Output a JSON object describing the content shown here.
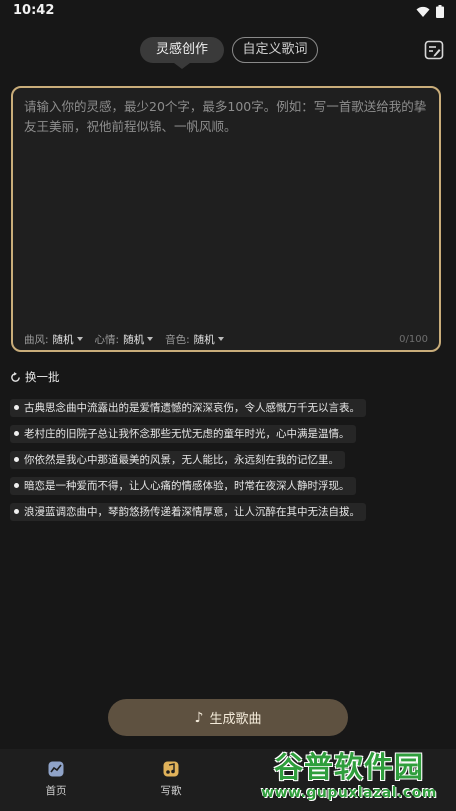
{
  "status_bar": {
    "time": "10:42"
  },
  "tabs": {
    "active": "灵感创作",
    "inactive": "自定义歌词"
  },
  "input": {
    "placeholder": "请输入你的灵感，最少20个字，最多100字。例如：写一首歌送给我的挚友王美丽，祝他前程似锦、一帆风顺。",
    "char_count": "0/100"
  },
  "options": [
    {
      "label": "曲风:",
      "value": "随机"
    },
    {
      "label": "心情:",
      "value": "随机"
    },
    {
      "label": "音色:",
      "value": "随机"
    }
  ],
  "refresh_label": "换一批",
  "suggestions": [
    "古典思念曲中流露出的是爱情遗憾的深深哀伤，令人感慨万千无以言表。",
    "老村庄的旧院子总让我怀念那些无忧无虑的童年时光，心中满是温情。",
    "你依然是我心中那道最美的风景，无人能比，永远刻在我的记忆里。",
    "暗恋是一种爱而不得，让人心痛的情感体验，时常在夜深人静时浮现。",
    "浪漫蓝调恋曲中，琴韵悠扬传递着深情厚意，让人沉醉在其中无法自拔。"
  ],
  "generate_button": "生成歌曲",
  "bottom_nav": [
    {
      "label": "首页",
      "icon": "home-chart-icon"
    },
    {
      "label": "写歌",
      "icon": "music-write-icon"
    }
  ],
  "watermark": {
    "title": "谷普软件园",
    "url": "www.gupuxlazal.com"
  },
  "colors": {
    "accent": "#c9ad7a",
    "button": "#5e5140",
    "background": "#171717"
  }
}
